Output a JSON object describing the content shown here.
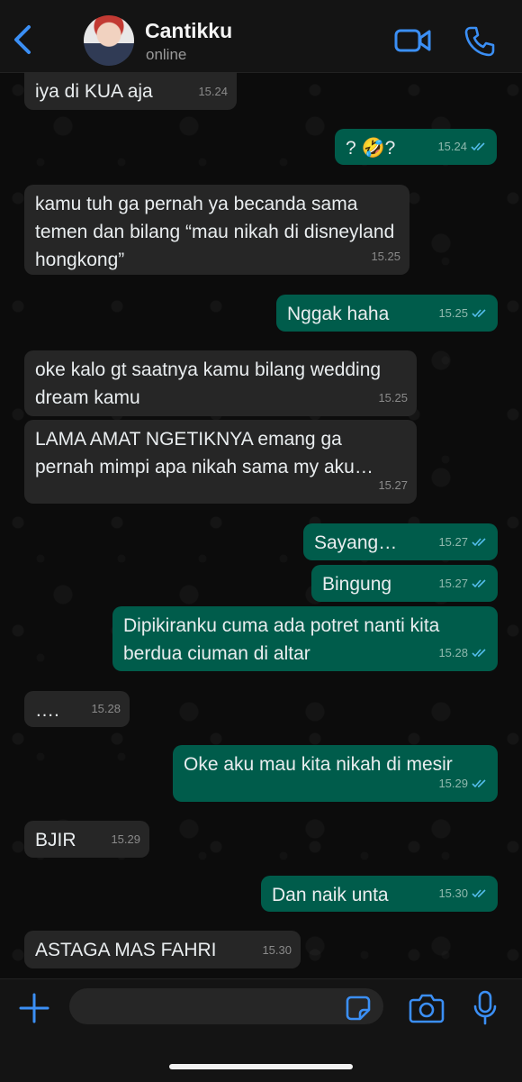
{
  "header": {
    "contact_name": "Cantikku",
    "status": "online"
  },
  "composer": {
    "placeholder": ""
  },
  "colors": {
    "accent": "#3b8ff5",
    "outgoing_bubble": "#005c4b",
    "incoming_bubble": "#262626",
    "read_ticks": "#53bdeb"
  },
  "messages": [
    {
      "direction": "in",
      "text": "iya di KUA aja",
      "time": "15.24"
    },
    {
      "direction": "out",
      "text": "? 🤣?",
      "time": "15.24",
      "status": "read"
    },
    {
      "direction": "in",
      "text": "kamu tuh ga pernah ya becanda sama temen dan bilang “mau nikah di disneyland hongkong”",
      "time": "15.25"
    },
    {
      "direction": "out",
      "text": "Nggak haha",
      "time": "15.25",
      "status": "read"
    },
    {
      "direction": "in",
      "text": "oke kalo gt saatnya kamu bilang wedding dream kamu",
      "time": "15.25"
    },
    {
      "direction": "in",
      "text": "LAMA AMAT NGETIKNYA emang ga pernah mimpi apa nikah sama my aku…",
      "time": "15.27"
    },
    {
      "direction": "out",
      "text": "Sayang…",
      "time": "15.27",
      "status": "read"
    },
    {
      "direction": "out",
      "text": "Bingung",
      "time": "15.27",
      "status": "read"
    },
    {
      "direction": "out",
      "text": "Dipikiranku cuma ada potret nanti kita berdua ciuman di altar",
      "time": "15.28",
      "status": "read"
    },
    {
      "direction": "in",
      "text": "….",
      "time": "15.28"
    },
    {
      "direction": "out",
      "text": "Oke aku mau kita nikah di mesir",
      "time": "15.29",
      "status": "read"
    },
    {
      "direction": "in",
      "text": "BJIR",
      "time": "15.29"
    },
    {
      "direction": "out",
      "text": "Dan naik unta",
      "time": "15.30",
      "status": "read"
    },
    {
      "direction": "in",
      "text": "ASTAGA MAS FAHRI",
      "time": "15.30"
    }
  ]
}
